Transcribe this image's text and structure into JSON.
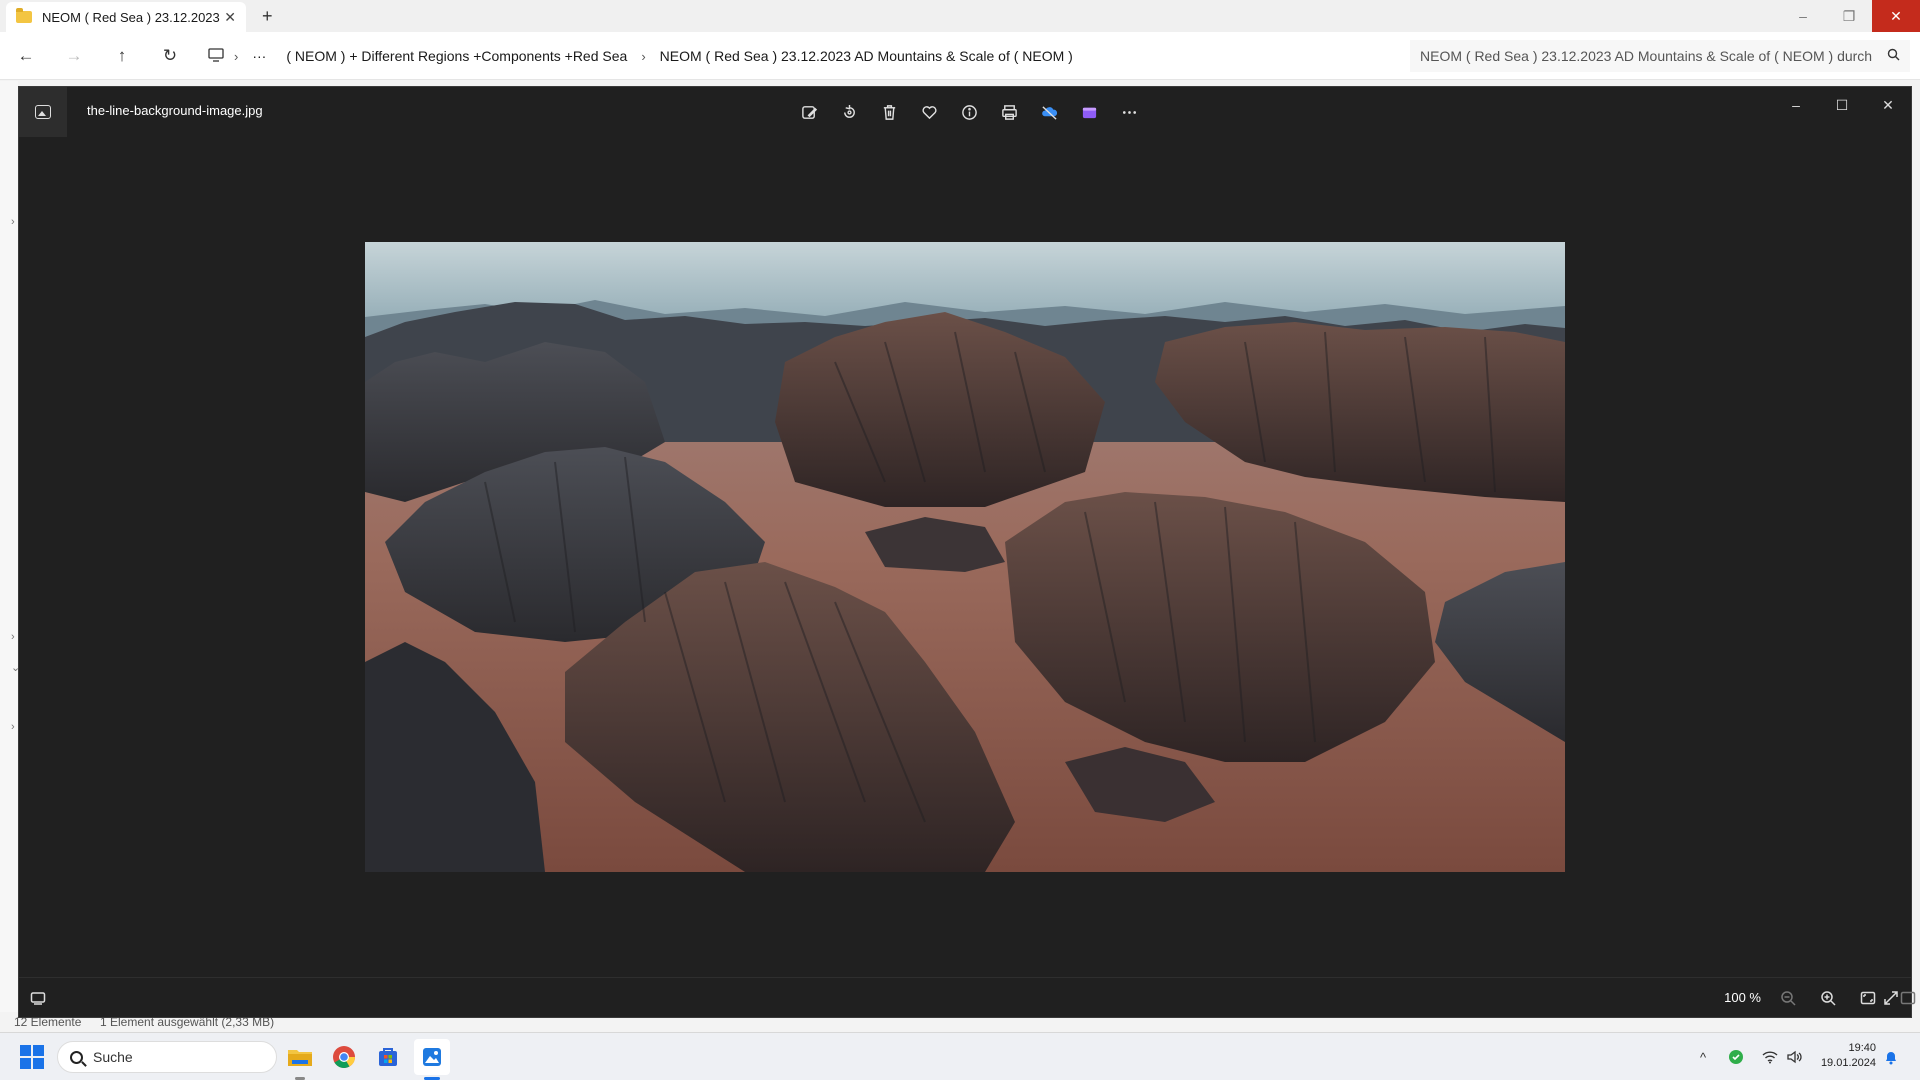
{
  "explorer": {
    "tab_title": "NEOM ( Red Sea )  23.12.2023",
    "tab_close": "✕",
    "new_tab": "+",
    "window_controls": {
      "minimize": "–",
      "maximize": "❐",
      "close": "✕"
    },
    "breadcrumbs": [
      "( NEOM ) + Different Regions +Components +Red Sea",
      "NEOM ( Red Sea )  23.12.2023 AD Mountains & Scale of ( NEOM )"
    ],
    "overflow": "···",
    "search_text": "NEOM ( Red Sea )  23.12.2023 AD Mountains & Scale of ( NEOM ) durch",
    "status_items": "12 Elemente",
    "status_selected": "1 Element ausgewählt (2,33 MB)"
  },
  "viewer": {
    "file_name": "the-line-background-image.jpg",
    "zoom_level": "100 %",
    "window_controls": {
      "minimize": "–",
      "maximize": "☐",
      "close": "✕"
    }
  },
  "taskbar": {
    "search_placeholder": "Suche",
    "time": "19:40",
    "date": "19.01.2024"
  },
  "colors": {
    "viewer_bg": "#202020",
    "close_red": "#c42b1c",
    "accent": "#1a73e8"
  }
}
